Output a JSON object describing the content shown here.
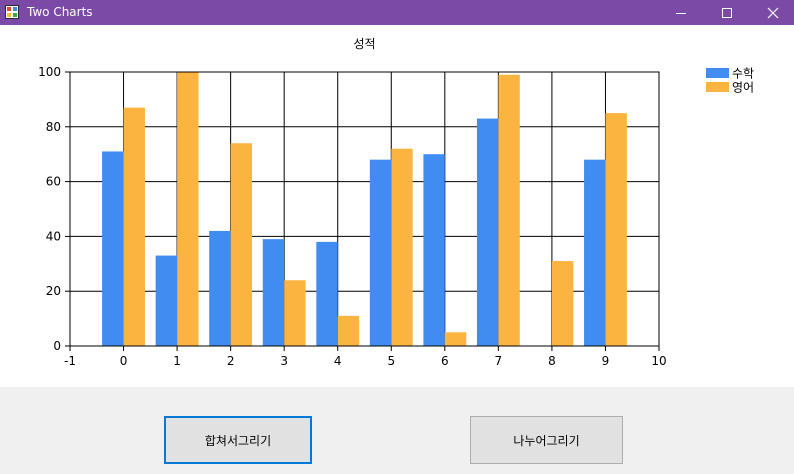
{
  "window": {
    "title": "Two Charts"
  },
  "buttons": {
    "merge_label": "합쳐서그리기",
    "split_label": "나누어그리기"
  },
  "colors": {
    "titlebar": "#7a4aa6",
    "series_math": "#418cf0",
    "series_english": "#fcb441"
  },
  "chart_data": {
    "type": "bar",
    "title": "성적",
    "xlabel": "",
    "ylabel": "",
    "xlim": [
      -1,
      10
    ],
    "ylim": [
      0,
      100
    ],
    "x_ticks": [
      -1,
      0,
      1,
      2,
      3,
      4,
      5,
      6,
      7,
      8,
      9,
      10
    ],
    "y_ticks": [
      0,
      20,
      40,
      60,
      80,
      100
    ],
    "x": [
      0,
      1,
      2,
      3,
      4,
      5,
      6,
      7,
      8,
      9
    ],
    "series": [
      {
        "name": "수학",
        "color": "#418cf0",
        "values": [
          71,
          33,
          42,
          39,
          38,
          68,
          70,
          83,
          0,
          68
        ]
      },
      {
        "name": "영어",
        "color": "#fcb441",
        "values": [
          87,
          100,
          74,
          24,
          11,
          72,
          5,
          99,
          31,
          85
        ]
      }
    ],
    "grid": true,
    "legend_position": "top-right"
  }
}
